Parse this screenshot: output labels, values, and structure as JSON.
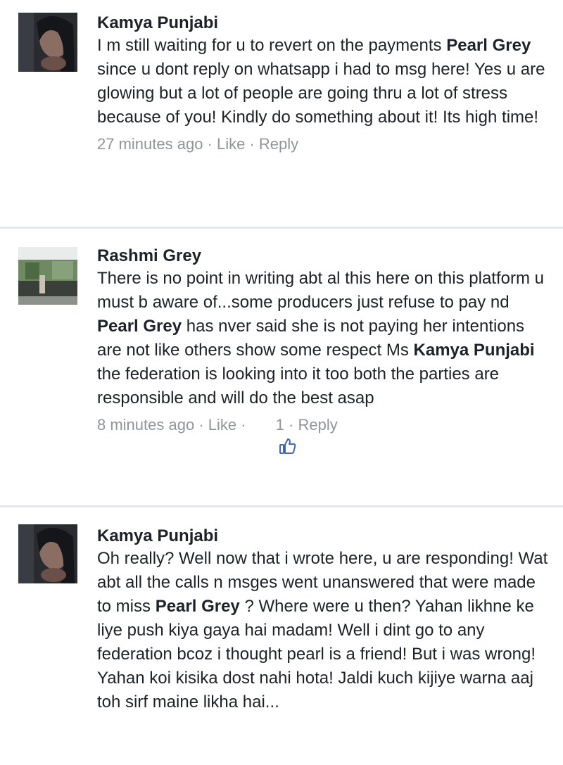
{
  "comments": [
    {
      "author": "Kamya Punjabi",
      "segments": [
        {
          "text": "I m still waiting for u to revert on the payments ",
          "bold": false
        },
        {
          "text": "Pearl Grey",
          "bold": true
        },
        {
          "text": " since u dont reply on whatsapp i had to msg here! Yes u are glowing but a lot of people are going thru a lot of stress because of you! Kindly do something about it! Its high time!",
          "bold": false
        }
      ],
      "time": "27 minutes ago",
      "like_label": "Like",
      "reply_label": "Reply",
      "separator": " · "
    },
    {
      "author": "Rashmi Grey",
      "segments": [
        {
          "text": "There is no point in writing abt al this here on this platform u must b aware of...some producers just refuse to pay nd ",
          "bold": false
        },
        {
          "text": "Pearl Grey",
          "bold": true
        },
        {
          "text": " has nver said she is not paying her intentions are not like others show some respect Ms ",
          "bold": false
        },
        {
          "text": "Kamya Punjabi",
          "bold": true
        },
        {
          "text": " the federation is looking into it too both the parties are responsible and will do the best asap",
          "bold": false
        }
      ],
      "time": "8 minutes ago",
      "like_label": "Like",
      "like_count": "1",
      "reply_label": "Reply",
      "separator": " · "
    },
    {
      "author": "Kamya Punjabi",
      "segments": [
        {
          "text": "Oh really? Well now that i wrote here, u are responding! Wat abt all the calls n msges went unanswered that were made to miss ",
          "bold": false
        },
        {
          "text": "Pearl Grey",
          "bold": true
        },
        {
          "text": " ? Where were u then? Yahan likhne ke liye push kiya gaya hai madam! Well i dint go to any federation bcoz i thought pearl is a friend! But i was wrong! Yahan koi kisika dost nahi hota! Jaldi kuch kijiye warna aaj toh sirf maine likha hai...",
          "bold": false
        }
      ]
    }
  ],
  "colors": {
    "text": "#1d2129",
    "meta": "#90949c",
    "like_blue": "#4267b2",
    "divider": "#e4e6eb"
  }
}
